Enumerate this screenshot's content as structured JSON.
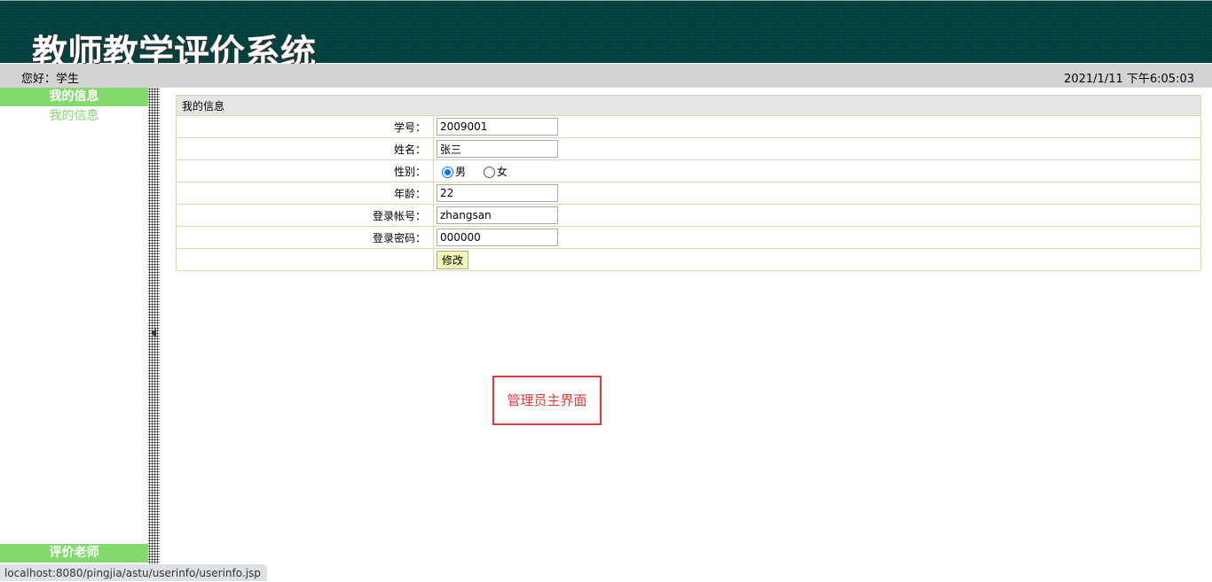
{
  "header": {
    "title": "教师教学评价系统"
  },
  "topbar": {
    "greeting": "您好：学生",
    "datetime": "2021/1/11 下午6:05:03"
  },
  "sidebar": {
    "sections": [
      {
        "title": "我的信息",
        "items": [
          "我的信息"
        ]
      },
      {
        "title": "评价老师"
      }
    ]
  },
  "form": {
    "caption": "我的信息",
    "student_id_label": "学号：",
    "student_id": "2009001",
    "name_label": "姓名：",
    "name": "张三",
    "gender_label": "性别：",
    "gender_options": [
      "男",
      "女"
    ],
    "gender_selected": "男",
    "age_label": "年龄：",
    "age": "22",
    "account_label": "登录帐号：",
    "account": "zhangsan",
    "password_label": "登录密码：",
    "password": "000000",
    "submit_label": "修改"
  },
  "overlay": {
    "label": "管理员主界面"
  },
  "statusbar": {
    "url": "localhost:8080/pingjia/astu/userinfo/userinfo.jsp"
  }
}
